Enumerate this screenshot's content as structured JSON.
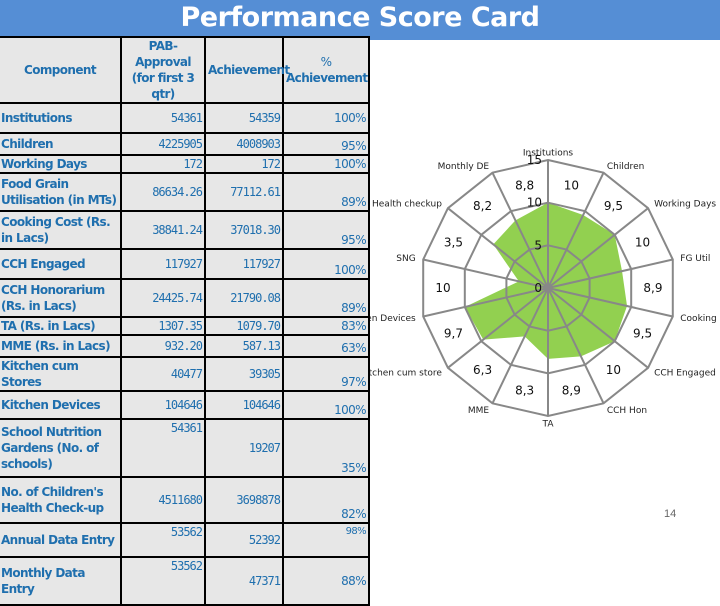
{
  "header": {
    "title": "Performance Score Card"
  },
  "table": {
    "columns": [
      "Component",
      "PAB-Approval (for first 3 qtr)",
      "Achievement",
      "% Achievement"
    ],
    "column_lines": {
      "pab": [
        "PAB-Approval",
        "(for first 3 qtr)"
      ],
      "pct": [
        "%",
        "Achievement"
      ]
    },
    "rows": [
      {
        "component": "Institutions",
        "approval": "54361",
        "achievement": "54359",
        "percent": "100%"
      },
      {
        "component": "Children",
        "approval": "4225905",
        "achievement": "4008903",
        "percent": "95%"
      },
      {
        "component": "Working Days",
        "approval": "172",
        "achievement": "172",
        "percent": "100%"
      },
      {
        "component": "Food Grain Utilisation (in MTs)",
        "approval": "86634.26",
        "achievement": "77112.61",
        "percent": "89%"
      },
      {
        "component": "Cooking Cost (Rs. in Lacs)",
        "approval": "38841.24",
        "achievement": "37018.30",
        "percent": "95%"
      },
      {
        "component": "CCH Engaged",
        "approval": "117927",
        "achievement": "117927",
        "percent": "100%"
      },
      {
        "component": "CCH Honorarium (Rs. in Lacs)",
        "approval": "24425.74",
        "achievement": "21790.08",
        "percent": "89%"
      },
      {
        "component": "TA (Rs. in Lacs)",
        "approval": "1307.35",
        "achievement": "1079.70",
        "percent": "83%"
      },
      {
        "component": "MME (Rs. in Lacs)",
        "approval": "932.20",
        "achievement": "587.13",
        "percent": "63%"
      },
      {
        "component": "Kitchen cum Stores",
        "approval": "40477",
        "achievement": "39305",
        "percent": "97%"
      },
      {
        "component": "Kitchen Devices",
        "approval": "104646",
        "achievement": "104646",
        "percent": "100%"
      },
      {
        "component": "School Nutrition Gardens (No. of schools)",
        "approval": "54361",
        "achievement": "19207",
        "percent": "35%"
      },
      {
        "component": "No. of Children's Health Check-up",
        "approval": "4511680",
        "achievement": "3698878",
        "percent": "82%"
      },
      {
        "component": "Annual Data Entry",
        "approval": "53562",
        "achievement": "52392",
        "percent": "98%"
      },
      {
        "component": "Monthly Data Entry",
        "approval": "53562",
        "achievement": "47371",
        "percent": "88%"
      }
    ]
  },
  "chart_data": {
    "type": "radar",
    "title": "",
    "axes": [
      "Institutions",
      "Children",
      "Working Days",
      "FG Util",
      "Cooking Co",
      "CCH Engaged",
      "CCH Hon",
      "TA",
      "MME",
      "Kitchen cum store",
      "Kitchen Devices",
      "SNG",
      "Health checkup",
      "Monthly DE"
    ],
    "values": [
      10,
      9.5,
      10,
      8.9,
      9.5,
      10,
      8.9,
      8.3,
      6.3,
      9.7,
      10,
      3.5,
      8.2,
      8.8
    ],
    "value_labels": [
      "10",
      "9,5",
      "10",
      "8,9",
      "9,5",
      "10",
      "8,9",
      "8,3",
      "6,3",
      "9,7",
      "10",
      "3,5",
      "8,2",
      "8,8"
    ],
    "scale_ticks": [
      0,
      5,
      10,
      15
    ],
    "range": [
      0,
      15
    ],
    "fill_color": "#92d050",
    "grid_color": "#888888",
    "legend": "none"
  },
  "footer": {
    "page_number": "14"
  }
}
